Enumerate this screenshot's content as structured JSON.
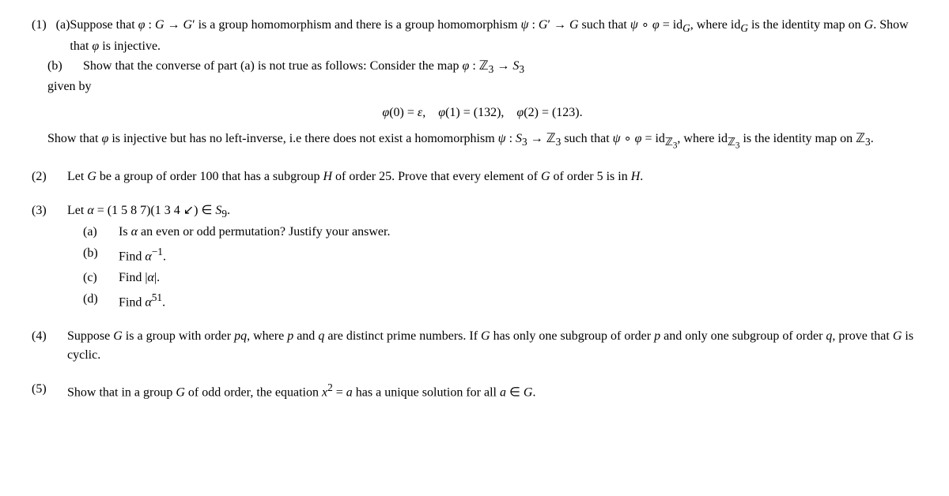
{
  "problems": [
    {
      "number": "(1)",
      "parts": [
        {
          "label": "(a)",
          "lines": [
            "Suppose that φ : G → G′ is a group homomorphism and there is a group homomorphism",
            "ψ : G′ → G such that ψ ∘ φ = id_G, where id_G is the identity map on G. Show that φ is injective."
          ]
        },
        {
          "label": "(b)",
          "intro": "Show that the converse of part (a) is not true as follows: Consider the map φ : ℤ₃ → S₃",
          "given": "given by",
          "formula": "φ(0) = ε,   φ(1) = (132),   φ(2) = (123).",
          "conclusion": "Show that φ is injective but has no left-inverse, i.e there does not exist a homomorphism ψ : S₃ → ℤ₃ such that ψ ∘ φ = id_ℤ₃, where id_ℤ₃ is the identity map on ℤ₃."
        }
      ]
    },
    {
      "number": "(2)",
      "text": "Let G be a group of order 100 that has a subgroup H of order 25. Prove that every element of G of order 5 is in H."
    },
    {
      "number": "(3)",
      "intro": "Let α = (1 5 8 7)(1 3 4 ↙) ∈ S₉.",
      "parts": [
        {
          "label": "(a)",
          "text": "Is α an even or odd permutation? Justify your answer."
        },
        {
          "label": "(b)",
          "text": "Find α⁻¹."
        },
        {
          "label": "(c)",
          "text": "Find |α|."
        },
        {
          "label": "(d)",
          "text": "Find α⁵¹."
        }
      ]
    },
    {
      "number": "(4)",
      "text": "Suppose G is a group with order pq, where p and q are distinct prime numbers. If G has only one subgroup of order p and only one subgroup of order q, prove that G is cyclic."
    },
    {
      "number": "(5)",
      "text": "Show that in a group G of odd order, the equation x² = a has a unique solution for all a ∈ G."
    }
  ]
}
